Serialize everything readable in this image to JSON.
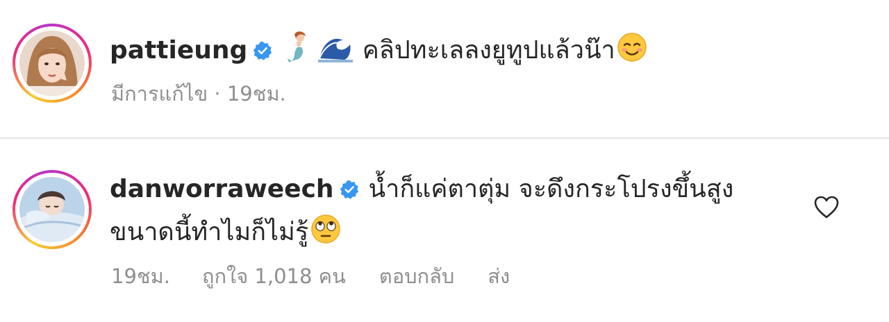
{
  "caption": {
    "username": "pattieung",
    "verified": true,
    "emojis_leading": [
      "mermaid-emoji",
      "wave-emoji"
    ],
    "text": "คลิปทะเลลงยูทูปแล้วน๊า",
    "emoji_trailing": "smiling-face-emoji",
    "meta": {
      "edited_label": "มีการแก้ไข",
      "separator": "·",
      "time": "19ชม."
    }
  },
  "comment": {
    "username": "danworraweech",
    "verified": true,
    "text_line1": "น้ำก็แค่ตาตุ่ม จะดึงกระโปรงขึ้นสูง",
    "text_line2": "ขนาดนี้ทำไมก็ไม่รู้",
    "emoji_trailing": "eye-roll-emoji",
    "meta": {
      "time": "19ชม.",
      "likes": "ถูกใจ 1,018 คน",
      "reply": "ตอบกลับ",
      "send": "ส่ง"
    }
  },
  "colors": {
    "text": "#262626",
    "meta": "#8e8e8e",
    "verified_blue": "#3897f0",
    "divider": "#e6e6e6"
  },
  "icons": {
    "verified": "verified-badge-icon",
    "like": "heart-outline-icon"
  }
}
